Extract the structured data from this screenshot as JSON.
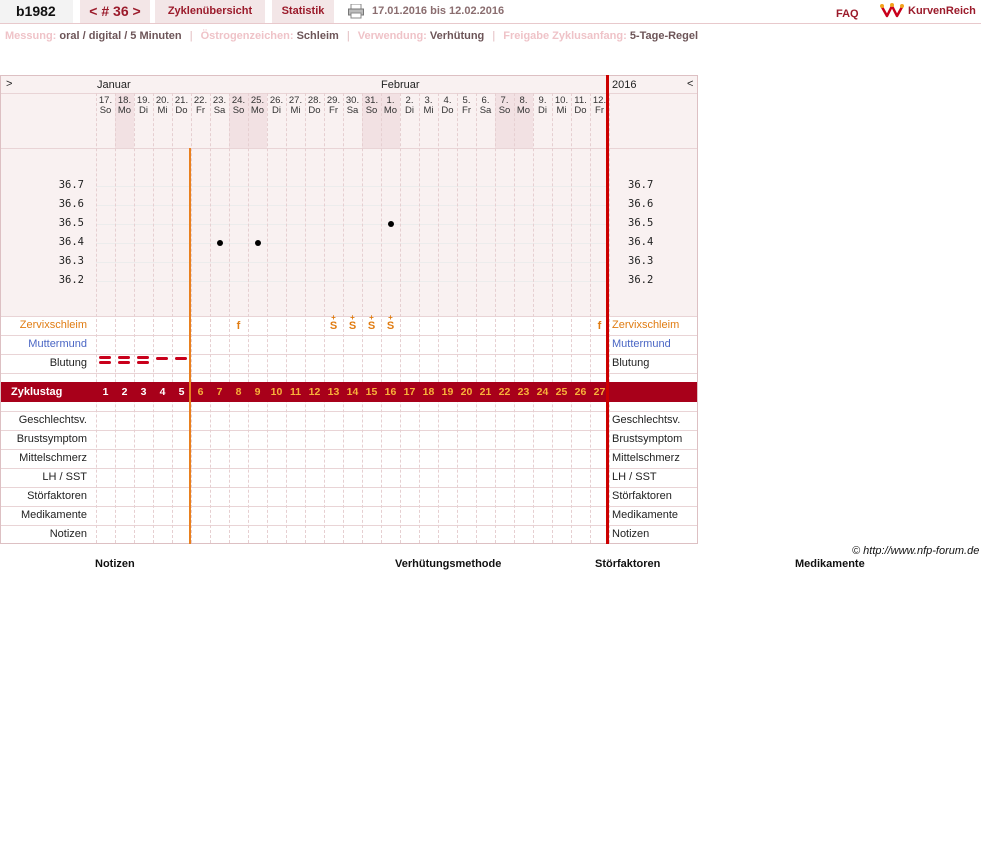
{
  "header": {
    "user": "b1982",
    "cycle_nav": {
      "prev": "<",
      "label": "# 36",
      "next": ">"
    },
    "tab_overview": "Zyklenübersicht",
    "tab_stats": "Statistik",
    "date_range": "17.01.2016 bis 12.02.2016",
    "faq": "FAQ",
    "logo_text": "KurvenReich"
  },
  "info": {
    "messung_label": "Messung:",
    "messung_value": "oral / digital / 5 Minuten",
    "oestrogen_label": "Östrogenzeichen:",
    "oestrogen_value": "Schleim",
    "verwendung_label": "Verwendung:",
    "verwendung_value": "Verhütung",
    "freigabe_label": "Freigabe Zyklusanfang:",
    "freigabe_value": "5-Tage-Regel"
  },
  "chart": {
    "nav_left": ">",
    "nav_right": "<",
    "month_jan": "Januar",
    "month_feb": "Februar",
    "year": "2016",
    "days": [
      {
        "d": "17.",
        "w": "So"
      },
      {
        "d": "18.",
        "w": "Mo"
      },
      {
        "d": "19.",
        "w": "Di"
      },
      {
        "d": "20.",
        "w": "Mi"
      },
      {
        "d": "21.",
        "w": "Do"
      },
      {
        "d": "22.",
        "w": "Fr"
      },
      {
        "d": "23.",
        "w": "Sa"
      },
      {
        "d": "24.",
        "w": "So"
      },
      {
        "d": "25.",
        "w": "Mo"
      },
      {
        "d": "26.",
        "w": "Di"
      },
      {
        "d": "27.",
        "w": "Mi"
      },
      {
        "d": "28.",
        "w": "Do"
      },
      {
        "d": "29.",
        "w": "Fr"
      },
      {
        "d": "30.",
        "w": "Sa"
      },
      {
        "d": "31.",
        "w": "So"
      },
      {
        "d": "1.",
        "w": "Mo"
      },
      {
        "d": "2.",
        "w": "Di"
      },
      {
        "d": "3.",
        "w": "Mi"
      },
      {
        "d": "4.",
        "w": "Do"
      },
      {
        "d": "5.",
        "w": "Fr"
      },
      {
        "d": "6.",
        "w": "Sa"
      },
      {
        "d": "7.",
        "w": "So"
      },
      {
        "d": "8.",
        "w": "Mo"
      },
      {
        "d": "9.",
        "w": "Di"
      },
      {
        "d": "10.",
        "w": "Mi"
      },
      {
        "d": "11.",
        "w": "Do"
      },
      {
        "d": "12.",
        "w": "Fr"
      }
    ],
    "weekend_days": [
      1,
      7,
      8,
      14,
      15,
      21,
      22
    ],
    "y_ticks": [
      "36.7",
      "36.6",
      "36.5",
      "36.4",
      "36.3",
      "36.2"
    ],
    "temperatures": [
      {
        "cycle_day": 7,
        "value": 36.4
      },
      {
        "cycle_day": 9,
        "value": 36.4
      },
      {
        "cycle_day": 16,
        "value": 36.5
      }
    ],
    "bleeding": [
      {
        "cycle_day": 1,
        "level": "strong"
      },
      {
        "cycle_day": 2,
        "level": "strong"
      },
      {
        "cycle_day": 3,
        "level": "strong"
      },
      {
        "cycle_day": 4,
        "level": "medium"
      },
      {
        "cycle_day": 5,
        "level": "medium"
      }
    ],
    "mucus": [
      {
        "cycle_day": 8,
        "symbol": "f"
      },
      {
        "cycle_day": 13,
        "symbol": "S",
        "plus": "+"
      },
      {
        "cycle_day": 14,
        "symbol": "S",
        "plus": "+"
      },
      {
        "cycle_day": 15,
        "symbol": "S",
        "plus": "+"
      },
      {
        "cycle_day": 16,
        "symbol": "S",
        "plus": "+"
      },
      {
        "cycle_day": 27,
        "symbol": "f"
      }
    ],
    "cycle_days": [
      "1",
      "2",
      "3",
      "4",
      "5",
      "6",
      "7",
      "8",
      "9",
      "10",
      "11",
      "12",
      "13",
      "14",
      "15",
      "16",
      "17",
      "18",
      "19",
      "20",
      "21",
      "22",
      "23",
      "24",
      "25",
      "26",
      "27"
    ],
    "pre_ovulation_days": 5,
    "row_labels": {
      "zervix": "Zervixschleim",
      "muttermund": "Muttermund",
      "blutung": "Blutung",
      "zyklustag": "Zyklustag",
      "geschlecht": "Geschlechtsv.",
      "brust": "Brustsymptom",
      "mittel": "Mittelschmerz",
      "lh": "LH / SST",
      "stoer": "Störfaktoren",
      "medi": "Medikamente",
      "notizen": "Notizen"
    }
  },
  "copyright": "© http://www.nfp-forum.de",
  "footer": {
    "notizen": "Notizen",
    "verhuetung": "Verhütungsmethode",
    "stoerfaktoren": "Störfaktoren",
    "medikamente": "Medikamente"
  },
  "colors": {
    "accent": "#9b1b2b",
    "cycle_bar": "#a8001a",
    "mucus": "#e07c12",
    "bleeding": "#c9001b"
  }
}
